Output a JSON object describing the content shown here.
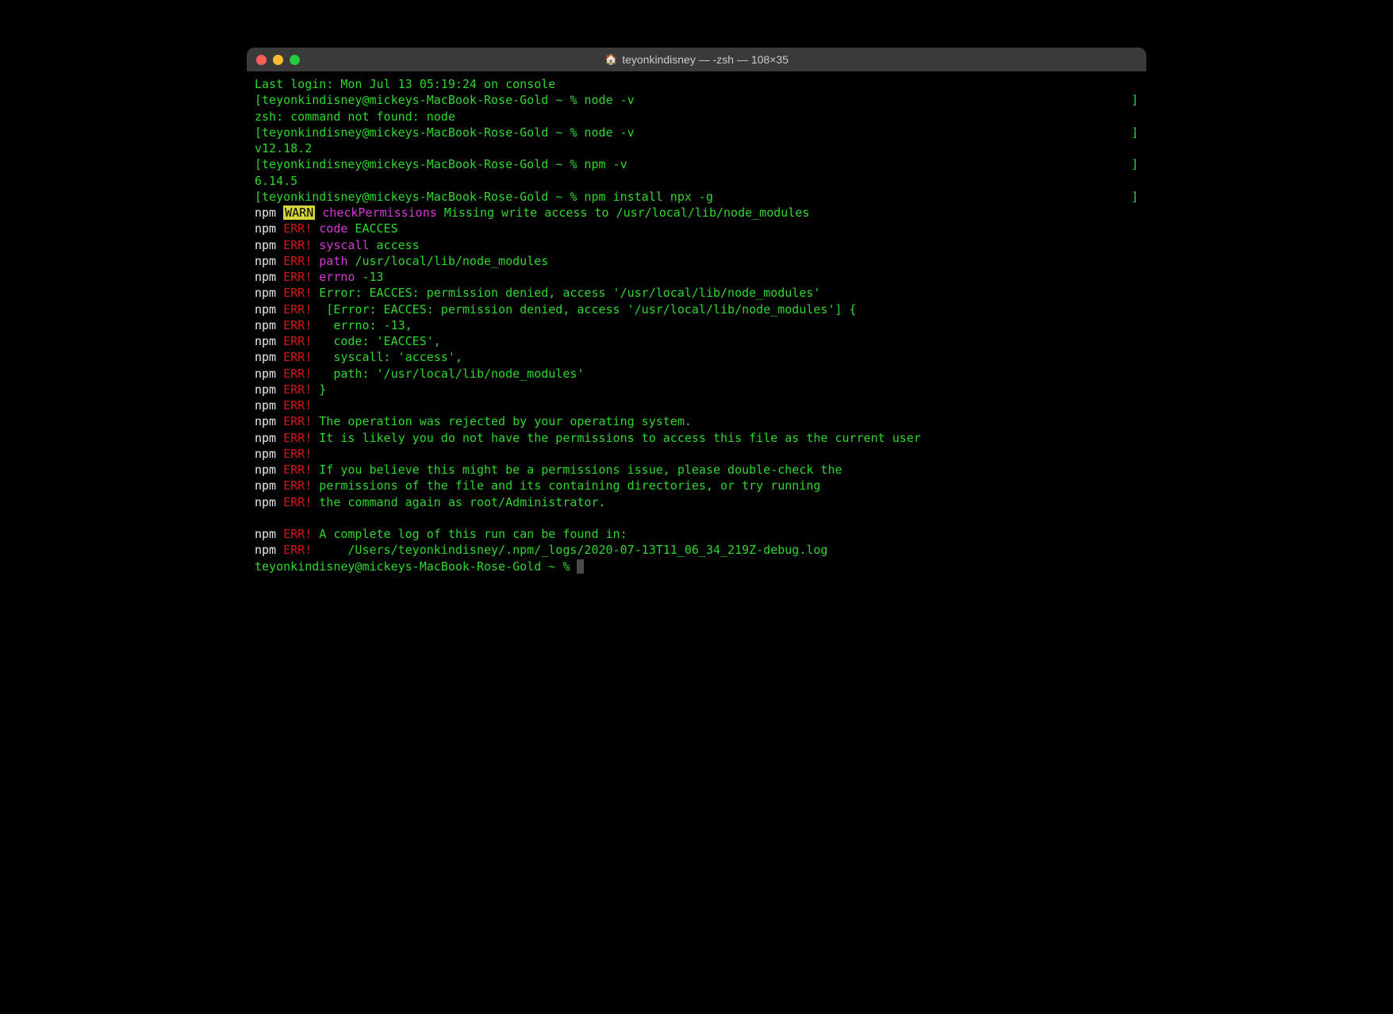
{
  "window": {
    "title": "teyonkindisney — -zsh — 108×35",
    "home_icon": "🏠"
  },
  "lines": {
    "last_login": "Last login: Mon Jul 13 05:19:24 on console",
    "prompt_user_host": "teyonkindisney@mickeys-MacBook-Rose-Gold ~ %",
    "cmd_node_v": "node -v",
    "zsh_not_found": "zsh: command not found: node",
    "node_version": "v12.18.2",
    "cmd_npm_v": "npm -v",
    "npm_version": "6.14.5",
    "cmd_npm_install": "npm install npx -g",
    "npm_label": "npm",
    "warn_label": "WARN",
    "err_label": "ERR!",
    "warn_check_perm": "checkPermissions",
    "warn_missing": " Missing write access to /usr/local/lib/node_modules",
    "code_label": "code",
    "code_val": " EACCES",
    "syscall_label": "syscall",
    "syscall_val": " access",
    "path_label": "path",
    "path_val": " /usr/local/lib/node_modules",
    "errno_label": "errno",
    "errno_val": " -13",
    "err_main": " Error: EACCES: permission denied, access '/usr/local/lib/node_modules'",
    "err_detail_open": "  [Error: EACCES: permission denied, access '/usr/local/lib/node_modules'] {",
    "err_errno": "   errno: -13,",
    "err_code": "   code: 'EACCES',",
    "err_syscall": "   syscall: 'access',",
    "err_path": "   path: '/usr/local/lib/node_modules'",
    "err_close": " }",
    "err_blank": "",
    "err_operation": " The operation was rejected by your operating system.",
    "err_likely": " It is likely you do not have the permissions to access this file as the current user",
    "err_believe": " If you believe this might be a permissions issue, please double-check the",
    "err_perms_file": " permissions of the file and its containing directories, or try running",
    "err_command_root": " the command again as root/Administrator.",
    "err_complete_log": " A complete log of this run can be found in:",
    "err_log_path": "     /Users/teyonkindisney/.npm/_logs/2020-07-13T11_06_34_219Z-debug.log",
    "lbracket": "[",
    "rbracket": "]"
  }
}
